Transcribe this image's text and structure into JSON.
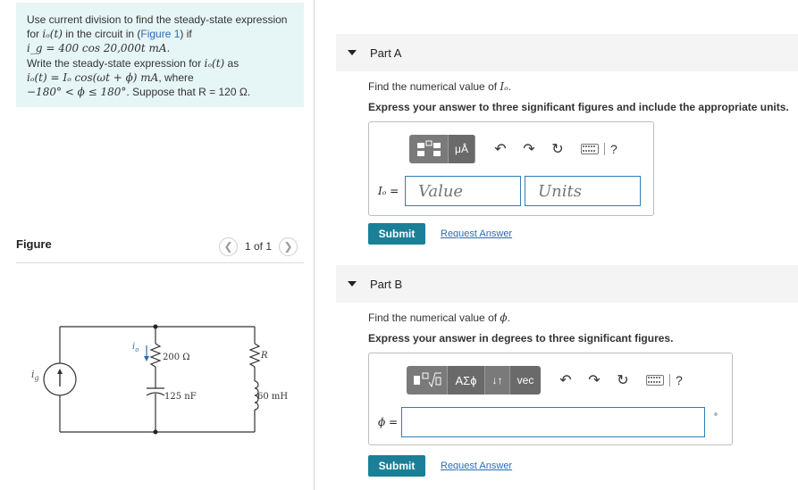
{
  "problem": {
    "line1": "Use current division to find the steady-state expression",
    "line2_a": "for ",
    "line2_math": "iₒ(t)",
    "line2_b": " in the circuit in (",
    "figure_link": "Figure 1",
    "line2_c": ") if",
    "line3_math": "i_g = 400 cos 20,000t mA.",
    "line4_a": "Write the steady-state expression for ",
    "line4_math": "iₒ(t)",
    "line4_b": " as",
    "line5_math": "iₒ(t) = Iₒ cos(ωt + ϕ) mA",
    "line5_b": ", where",
    "line6_math": "−180° < ϕ ≤ 180°",
    "line6_b": ". Suppose that R = 120 Ω."
  },
  "figure": {
    "heading": "Figure",
    "pager_label": "1 of 1",
    "prev_icon": "chevron-left-icon",
    "next_icon": "chevron-right-icon",
    "circuit": {
      "source_label": "i",
      "source_sub": "g",
      "current_label": "i",
      "current_sub": "o",
      "resistor_label": "200 Ω",
      "capacitor_label": "125 nF",
      "r_label": "R",
      "inductor_label": "60 mH"
    }
  },
  "partA": {
    "title": "Part A",
    "prompt": "Find the numerical value of ",
    "prompt_var": "Iₒ",
    "prompt_end": ".",
    "instruction": "Express your answer to three significant figures and include the appropriate units.",
    "toolbar": {
      "templates_icon": "templates-icon",
      "units_label": "μÅ",
      "undo_icon": "undo-icon",
      "redo_icon": "redo-icon",
      "reset_icon": "reset-icon",
      "keyboard_icon": "keyboard-icon",
      "help": "?"
    },
    "input_label": "Iₒ =",
    "value_placeholder": "Value",
    "units_placeholder": "Units",
    "submit": "Submit",
    "request": "Request Answer"
  },
  "partB": {
    "title": "Part B",
    "prompt": "Find the numerical value of ",
    "prompt_var": "ϕ",
    "prompt_end": ".",
    "instruction": "Express your answer in degrees to three significant figures.",
    "toolbar": {
      "templates_icon": "templates-icon",
      "greek_label": "AΣϕ",
      "arrows_label": "↓↑",
      "vec_label": "vec",
      "undo_icon": "undo-icon",
      "redo_icon": "redo-icon",
      "reset_icon": "reset-icon",
      "keyboard_icon": "keyboard-icon",
      "help": "?"
    },
    "input_label": "ϕ =",
    "unit_suffix": "°",
    "submit": "Submit",
    "request": "Request Answer"
  },
  "colors": {
    "problem_bg": "#e6f5f6",
    "submit": "#1a7f97",
    "link": "#2a6db5",
    "input_border": "#2c7fb8",
    "toolbar_btn": "#7a7a7a"
  }
}
